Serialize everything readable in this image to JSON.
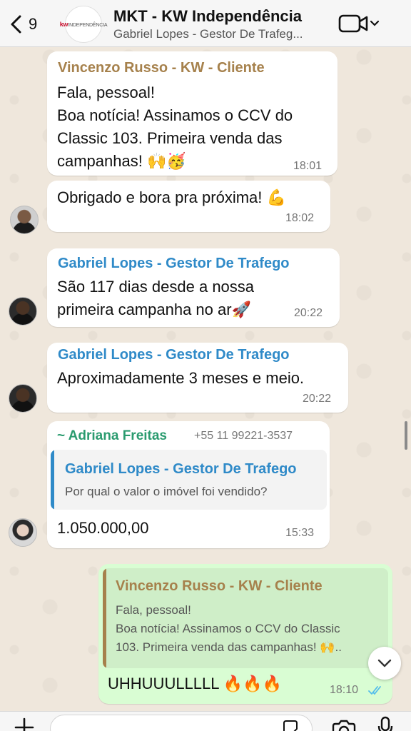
{
  "header": {
    "back_count": "9",
    "title": "MKT - KW Independência",
    "subtitle": "Gabriel Lopes - Gestor De Trafeg...",
    "logo_kw": "kw",
    "logo_text": "INDEPENDÊNCIA"
  },
  "messages": [
    {
      "sender": "Vincenzo Russo - KW - Cliente",
      "lines": [
        "Fala, pessoal!",
        "Boa notícia! Assinamos o CCV do",
        "Classic 103. Primeira venda das",
        "campanhas! 🙌🥳"
      ],
      "time": "18:01"
    },
    {
      "lines": [
        "Obrigado e bora pra próxima! 💪"
      ],
      "time": "18:02"
    },
    {
      "sender": "Gabriel Lopes - Gestor De Trafego",
      "lines": [
        "São 117 dias desde a nossa",
        "primeira campanha no ar🚀"
      ],
      "time": "20:22"
    },
    {
      "sender": "Gabriel Lopes - Gestor De Trafego",
      "lines": [
        "Aproximadamente 3 meses e meio."
      ],
      "time": "20:22"
    },
    {
      "sender": "~ Adriana Freitas",
      "phone": "+55 11 99221-3537",
      "quote": {
        "sender": "Gabriel Lopes - Gestor De Trafego",
        "text": "Por qual o valor o imóvel foi vendido?"
      },
      "lines": [
        "1.050.000,00"
      ],
      "time": "15:33"
    },
    {
      "quote": {
        "sender": "Vincenzo Russo - KW - Cliente",
        "lines": [
          "Fala, pessoal!",
          "Boa notícia! Assinamos o CCV do Classic",
          "103. Primeira venda das campanhas! 🙌.."
        ]
      },
      "lines": [
        "UHHUUULLLLL 🔥🔥🔥"
      ],
      "time": "18:10"
    }
  ],
  "colors": {
    "gold_sender": "#a6814c",
    "blue_sender": "#2f8ac8",
    "green_sender": "#2a9b6f",
    "outgoing_bubble": "#d9fdd3",
    "read_ticks": "#53bdeb"
  }
}
